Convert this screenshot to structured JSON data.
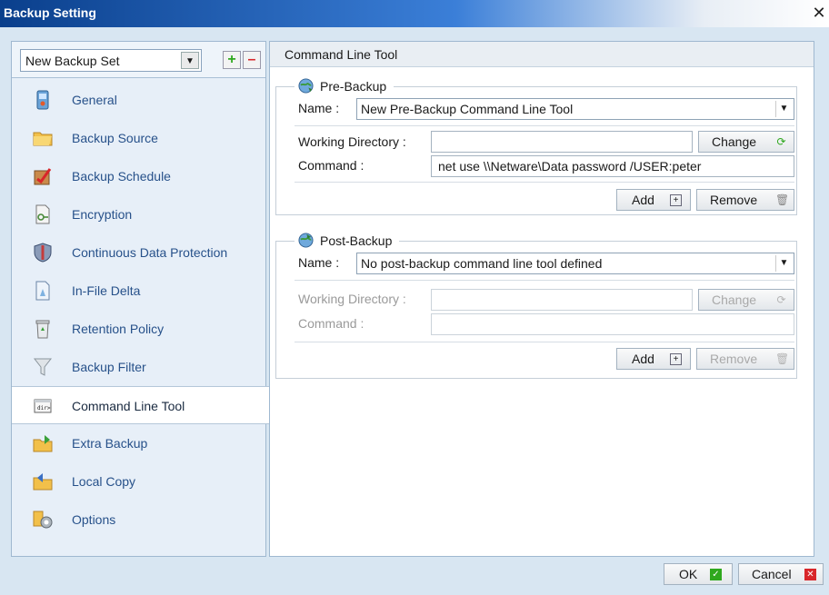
{
  "window": {
    "title": "Backup Setting",
    "close_glyph": "✕"
  },
  "backup_set": {
    "selected": "New Backup Set",
    "add_glyph": "+",
    "remove_glyph": "–"
  },
  "sidebar": {
    "items": [
      {
        "label": "General",
        "icon": "general-icon"
      },
      {
        "label": "Backup Source",
        "icon": "folder-icon"
      },
      {
        "label": "Backup Schedule",
        "icon": "schedule-icon"
      },
      {
        "label": "Encryption",
        "icon": "encryption-icon"
      },
      {
        "label": "Continuous Data Protection",
        "icon": "shield-icon"
      },
      {
        "label": "In-File Delta",
        "icon": "delta-icon"
      },
      {
        "label": "Retention Policy",
        "icon": "recycle-bin-icon"
      },
      {
        "label": "Backup Filter",
        "icon": "filter-icon"
      },
      {
        "label": "Command Line Tool",
        "icon": "command-line-icon",
        "active": true
      },
      {
        "label": "Extra Backup",
        "icon": "extra-backup-icon"
      },
      {
        "label": "Local Copy",
        "icon": "local-copy-icon"
      },
      {
        "label": "Options",
        "icon": "options-icon"
      }
    ]
  },
  "panel": {
    "title": "Command Line Tool"
  },
  "pre_backup": {
    "legend": "Pre-Backup",
    "name_label": "Name :",
    "name_value": "New Pre-Backup Command Line Tool",
    "workdir_label": "Working Directory :",
    "workdir_value": "",
    "change_label": "Change",
    "command_label": "Command :",
    "command_value": "net use \\\\Netware\\Data password /USER:peter",
    "add_label": "Add",
    "remove_label": "Remove"
  },
  "post_backup": {
    "legend": "Post-Backup",
    "name_label": "Name :",
    "name_value": "No post-backup command line tool defined",
    "workdir_label": "Working Directory :",
    "workdir_value": "",
    "change_label": "Change",
    "command_label": "Command :",
    "command_value": "",
    "add_label": "Add",
    "remove_label": "Remove"
  },
  "footer": {
    "ok_label": "OK",
    "cancel_label": "Cancel"
  },
  "colors": {
    "title_start": "#0a3f8c",
    "link_blue": "#27518a",
    "ok_green": "#2fa81e",
    "cancel_red": "#d8262a"
  }
}
